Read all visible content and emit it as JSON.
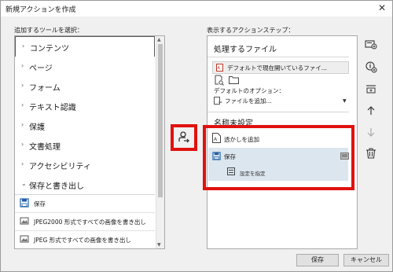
{
  "window": {
    "title": "新規アクションを作成"
  },
  "left": {
    "label": "追加するツールを選択：",
    "categories": [
      {
        "label": "コンテンツ"
      },
      {
        "label": "ページ"
      },
      {
        "label": "フォーム"
      },
      {
        "label": "テキスト認識"
      },
      {
        "label": "保護"
      },
      {
        "label": "文書処理"
      },
      {
        "label": "アクセシビリティ"
      },
      {
        "label": "保存と書き出し"
      }
    ],
    "subitems": [
      {
        "label": "保存",
        "icon": "save-icon"
      },
      {
        "label": "JPEG2000 形式ですべての画像を書き出し",
        "icon": "image-export-icon"
      },
      {
        "label": "JPEG 形式ですべての画像を書き出し",
        "icon": "image-export-icon"
      }
    ]
  },
  "right": {
    "label": "表示するアクションステップ：",
    "file_section_title": "処理するファイル",
    "file_input_value": "デフォルトで現在開いているファイ...",
    "default_option_label": "デフォルトのオプション：",
    "default_option_value": "ファイルを追加...",
    "step_title": "名称未設定",
    "steps": [
      {
        "label": "透かしを追加"
      },
      {
        "label": "保存"
      },
      {
        "label": "設定を指定"
      }
    ]
  },
  "footer": {
    "save": "保存",
    "cancel": "キャンセル"
  },
  "colors": {
    "highlight_red": "#e1110f",
    "selected_step": "#dce6ef",
    "accent_blue": "#1f5fa6"
  }
}
